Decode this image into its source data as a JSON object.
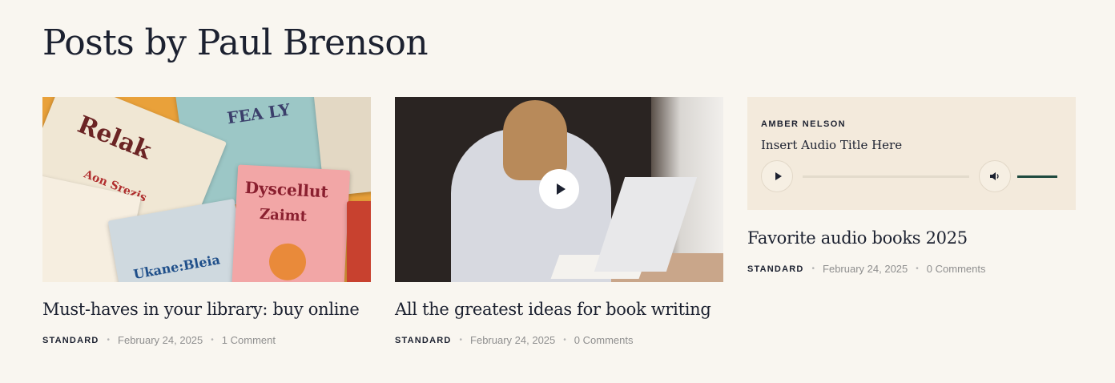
{
  "page": {
    "title": "Posts by Paul Brenson"
  },
  "posts": [
    {
      "title": "Must-haves in your library: buy online",
      "category": "STANDARD",
      "date": "February 24, 2025",
      "comments": "1 Comment",
      "media": "image",
      "image_text": [
        "Relak",
        "Aon Srezis",
        "FEA LY",
        "Dyscellut",
        "Zaimt",
        "Ukane:Bleia"
      ]
    },
    {
      "title": "All the greatest ideas for book writing",
      "category": "STANDARD",
      "date": "February 24, 2025",
      "comments": "0 Comments",
      "media": "video"
    },
    {
      "title": "Favorite audio books 2025",
      "category": "STANDARD",
      "date": "February 24, 2025",
      "comments": "0 Comments",
      "media": "audio",
      "audio": {
        "author": "AMBER NELSON",
        "title": "Insert Audio Title Here",
        "progress": 0,
        "volume": 1.0
      }
    }
  ],
  "icons": {
    "play": "play-icon",
    "volume": "volume-icon"
  },
  "colors": {
    "background": "#f9f6f0",
    "audio_box": "#f3eadc",
    "accent": "#1e4a3f",
    "text": "#1c2130",
    "meta": "#8f8f8f"
  }
}
